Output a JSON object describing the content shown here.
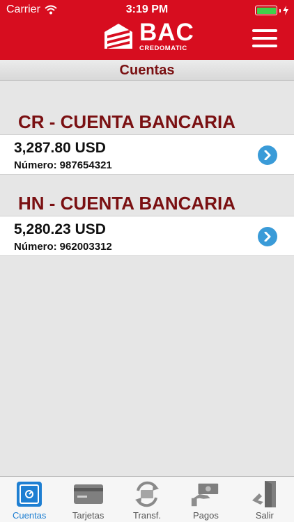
{
  "status": {
    "carrier": "Carrier",
    "time": "3:19 PM"
  },
  "header": {
    "brand": "BAC",
    "brand_sub": "CREDOMATIC"
  },
  "page_title": "Cuentas",
  "accounts": [
    {
      "heading": "CR - CUENTA BANCARIA",
      "amount": "3,287.80 USD",
      "number_label": "Número:",
      "number": "987654321"
    },
    {
      "heading": "HN - CUENTA BANCARIA",
      "amount": "5,280.23 USD",
      "number_label": "Número:",
      "number": "962003312"
    }
  ],
  "tabs": [
    {
      "label": "Cuentas",
      "icon": "safe-icon",
      "active": true
    },
    {
      "label": "Tarjetas",
      "icon": "card-icon"
    },
    {
      "label": "Transf.",
      "icon": "transfer-icon"
    },
    {
      "label": "Pagos",
      "icon": "payment-icon"
    },
    {
      "label": "Salir",
      "icon": "exit-door-icon"
    }
  ],
  "colors": {
    "header_red": "#d70d1f",
    "heading_maroon": "#7a1012",
    "accent_blue": "#1e7fd2",
    "chevron_blue": "#3a9bd8"
  }
}
